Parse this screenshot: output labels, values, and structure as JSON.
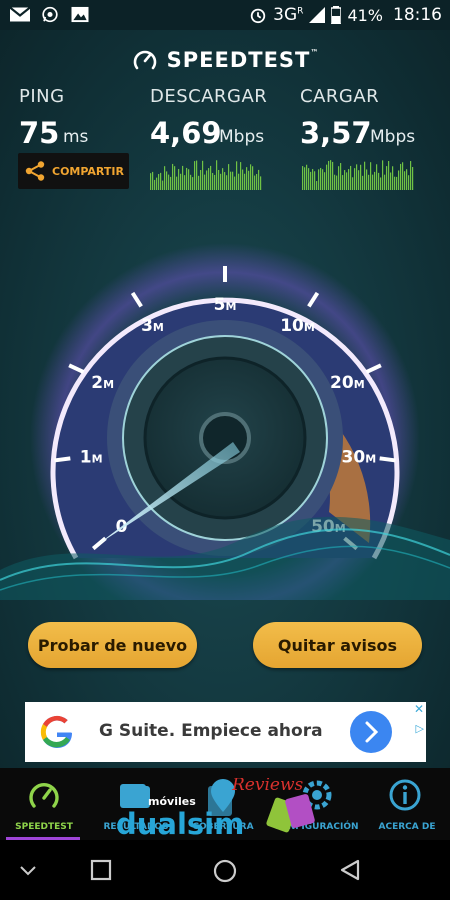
{
  "status_bar": {
    "network": "3G",
    "network_sup": "R",
    "battery": "41%",
    "time": "18:16"
  },
  "app": {
    "title": "SPEEDTEST",
    "trademark": "™"
  },
  "metrics": {
    "ping": {
      "label": "PING",
      "value": "75",
      "unit": "ms"
    },
    "download": {
      "label": "DESCARGAR",
      "value": "4,69",
      "unit": "Mbps"
    },
    "upload": {
      "label": "CARGAR",
      "value": "3,57",
      "unit": "Mbps"
    }
  },
  "share_button": {
    "label": "COMPARTIR"
  },
  "gauge": {
    "ticks": [
      {
        "num": "0",
        "unit": ""
      },
      {
        "num": "1",
        "unit": "M"
      },
      {
        "num": "2",
        "unit": "M"
      },
      {
        "num": "3",
        "unit": "M"
      },
      {
        "num": "5",
        "unit": "M"
      },
      {
        "num": "10",
        "unit": "M"
      },
      {
        "num": "20",
        "unit": "M"
      },
      {
        "num": "30",
        "unit": "M"
      },
      {
        "num": "50",
        "unit": "M"
      }
    ]
  },
  "actions": {
    "retry_label": "Probar de nuevo",
    "remove_ads_label": "Quitar avisos"
  },
  "ad": {
    "text": "G Suite. Empiece ahora",
    "close": "✕",
    "info": "▷"
  },
  "tabs": [
    {
      "label": "SPEEDTEST"
    },
    {
      "label": "RESULTADOS"
    },
    {
      "label": "COBERTURA"
    },
    {
      "label": "CONFIGURACIÓN"
    },
    {
      "label": "ACERCA DE"
    }
  ],
  "watermark": {
    "brand": "dualsim",
    "prefix": "móviles",
    "script": "Reviews"
  },
  "colors": {
    "accent_orange": "#f1a531",
    "accent_green": "#8fd44a",
    "accent_blue": "#3aa4d2",
    "gauge_purple": "#8a5ad8",
    "button_gold": "#e9ad38"
  }
}
